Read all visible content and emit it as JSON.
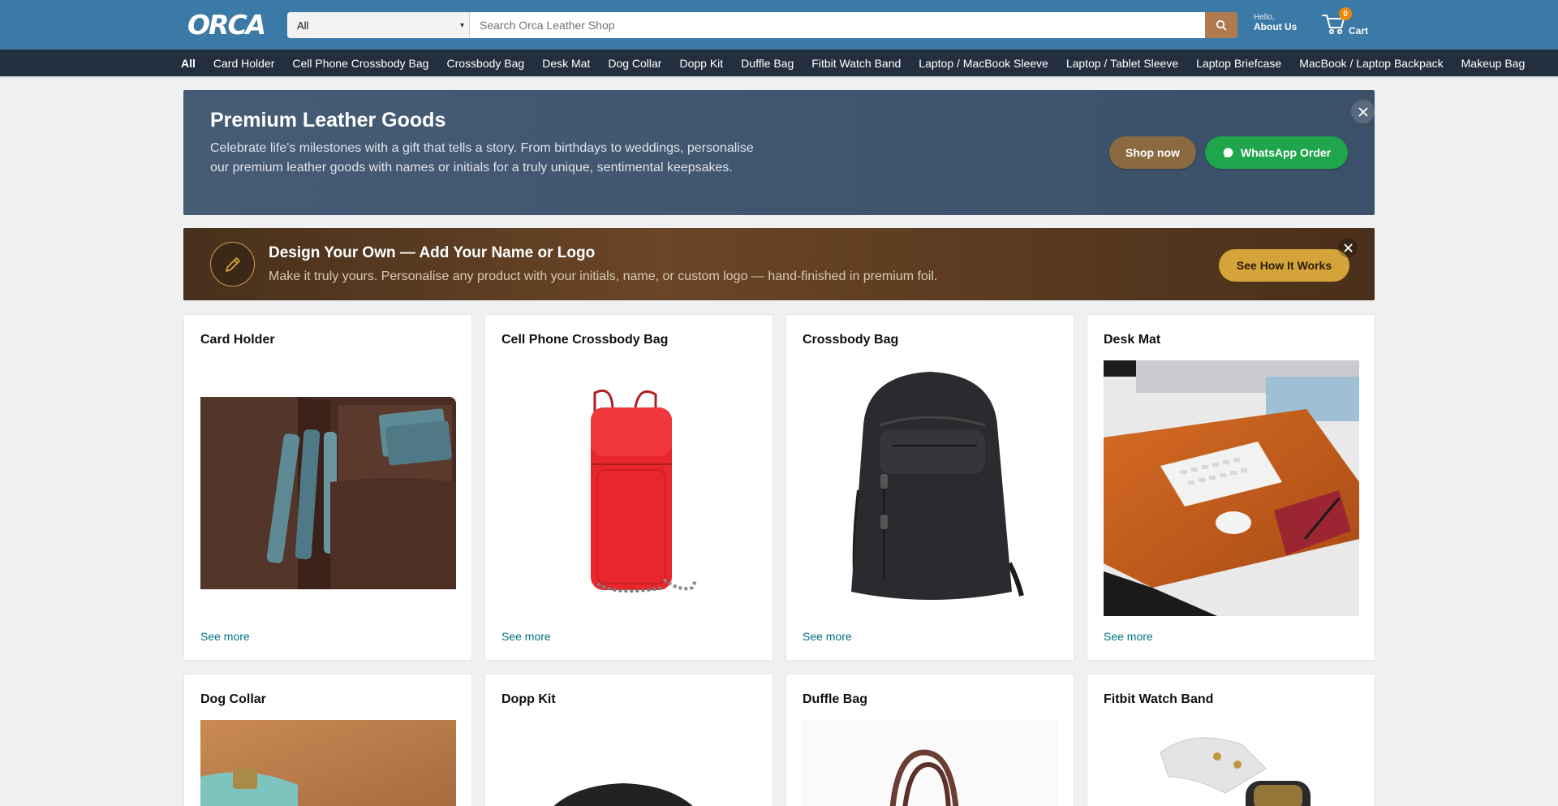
{
  "header": {
    "logo_text": "ORCA",
    "search": {
      "category": "All",
      "placeholder": "Search Orca Leather Shop"
    },
    "account": {
      "hello": "Hello,",
      "label": "About Us"
    },
    "cart": {
      "count": "0",
      "label": "Cart"
    },
    "colors": {
      "topbar": "#3b79a6",
      "navbar": "#232f3e",
      "search_button": "#b07a4f",
      "cart_badge": "#f08804"
    }
  },
  "nav": {
    "items": [
      "All",
      "Card Holder",
      "Cell Phone Crossbody Bag",
      "Crossbody Bag",
      "Desk Mat",
      "Dog Collar",
      "Dopp Kit",
      "Duffle Bag",
      "Fitbit Watch Band",
      "Laptop / MacBook Sleeve",
      "Laptop / Tablet Sleeve",
      "Laptop Briefcase",
      "MacBook / Laptop Backpack",
      "Makeup Bag"
    ]
  },
  "promo": {
    "title": "Premium Leather Goods",
    "text": "Celebrate life's milestones with a gift that tells a story. From birthdays to weddings, personalise our premium leather goods with names or initials for a truly unique, sentimental keepsakes.",
    "shop_label": "Shop now",
    "whatsapp_label": "WhatsApp Order"
  },
  "design": {
    "title": "Design Your Own — Add Your Name or Logo",
    "text": "Make it truly yours. Personalise any product with your initials, name, or custom logo — hand-finished in premium foil.",
    "button_label": "See How It Works"
  },
  "cards": [
    {
      "title": "Card Holder",
      "link": "See more",
      "image": "card-holder-image"
    },
    {
      "title": "Cell Phone Crossbody Bag",
      "link": "See more",
      "image": "crossbody-phone-bag-image"
    },
    {
      "title": "Crossbody Bag",
      "link": "See more",
      "image": "backpack-image"
    },
    {
      "title": "Desk Mat",
      "link": "See more",
      "image": "desk-mat-image"
    },
    {
      "title": "Dog Collar",
      "image": "dog-collar-image"
    },
    {
      "title": "Dopp Kit",
      "image": "dopp-kit-image"
    },
    {
      "title": "Duffle Bag",
      "image": "duffle-bag-image"
    },
    {
      "title": "Fitbit Watch Band",
      "image": "watch-band-image"
    }
  ]
}
